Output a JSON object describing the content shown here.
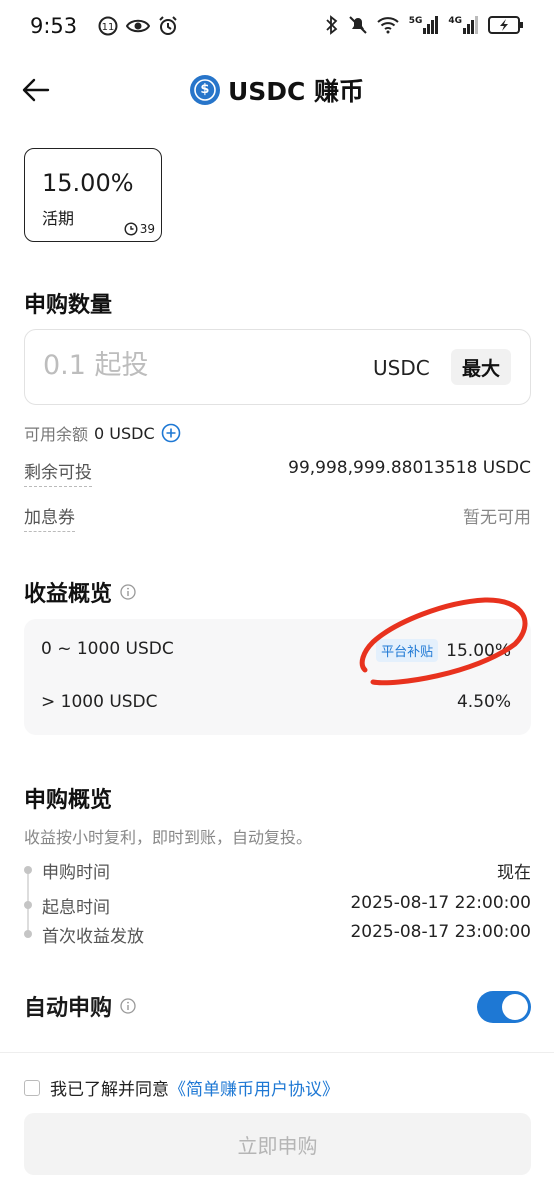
{
  "status_bar": {
    "time": "9:53",
    "network_5g": "5G",
    "network_4g": "4G"
  },
  "header": {
    "title": "USDC 赚币",
    "coin_symbol": "$"
  },
  "rate_card": {
    "rate": "15.00%",
    "type": "活期",
    "timer": "39"
  },
  "subscribe": {
    "section_title": "申购数量",
    "amount_placeholder": "0.1 起投",
    "unit": "USDC",
    "max_label": "最大",
    "balance_label": "可用余额",
    "balance_value": "0 USDC",
    "remaining_label": "剩余可投",
    "remaining_value": "99,998,999.88013518 USDC",
    "coupon_label": "加息券",
    "coupon_value": "暂无可用"
  },
  "earnings": {
    "section_title": "收益概览",
    "tiers": [
      {
        "range": "0 ~ 1000 USDC",
        "tag": "平台补贴",
        "rate": "15.00%"
      },
      {
        "range": "> 1000 USDC",
        "tag": "",
        "rate": "4.50%"
      }
    ]
  },
  "overview": {
    "section_title": "申购概览",
    "description": "收益按小时复利，即时到账，自动复投。",
    "timeline": [
      {
        "label": "申购时间",
        "value": "现在"
      },
      {
        "label": "起息时间",
        "value": "2025-08-17 22:00:00"
      },
      {
        "label": "首次收益发放",
        "value": "2025-08-17 23:00:00"
      }
    ]
  },
  "auto_subscribe": {
    "label": "自动申购",
    "enabled": true
  },
  "agreement": {
    "text": "我已了解并同意",
    "link": "《简单赚币用户协议》"
  },
  "submit": {
    "label": "立即申购"
  },
  "colors": {
    "accent": "#1e78d4",
    "annotation": "#e8321e"
  }
}
